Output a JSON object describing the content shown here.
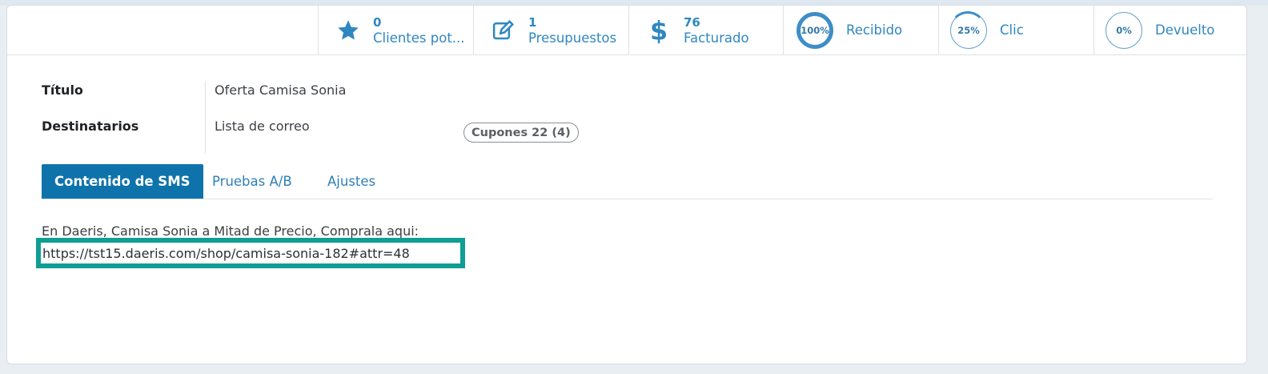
{
  "stat_buttons": [
    {
      "value": "0",
      "label": "Clientes pot...",
      "icon": "star-icon"
    },
    {
      "value": "1",
      "label": "Presupuestos",
      "icon": "edit-icon"
    },
    {
      "value": "76",
      "label": "Facturado",
      "icon": "dollar-icon"
    }
  ],
  "rate_buttons": [
    {
      "percent": "100%",
      "label": "Recibido"
    },
    {
      "percent": "25%",
      "label": "Clic"
    },
    {
      "percent": "0%",
      "label": "Devuelto"
    }
  ],
  "fields": {
    "title_label": "Título",
    "title_value": "Oferta Camisa Sonia",
    "recipients_label": "Destinatarios",
    "recipients_value": "Lista de correo",
    "mailing_list_badge": "Cupones 22 (4)"
  },
  "tabs": [
    {
      "label": "Contenido de SMS",
      "active": true
    },
    {
      "label": "Pruebas A/B",
      "active": false
    },
    {
      "label": "Ajustes",
      "active": false
    }
  ],
  "sms": {
    "line1": "En Daeris, Camisa Sonia a Mitad de Precio, Comprala aqui:",
    "link": "https://tst15.daeris.com/shop/camisa-sonia-182#attr=48"
  },
  "colors": {
    "accent": "#2f87c1",
    "active_tab": "#0f73ab",
    "highlight_box": "#0e9e93"
  }
}
